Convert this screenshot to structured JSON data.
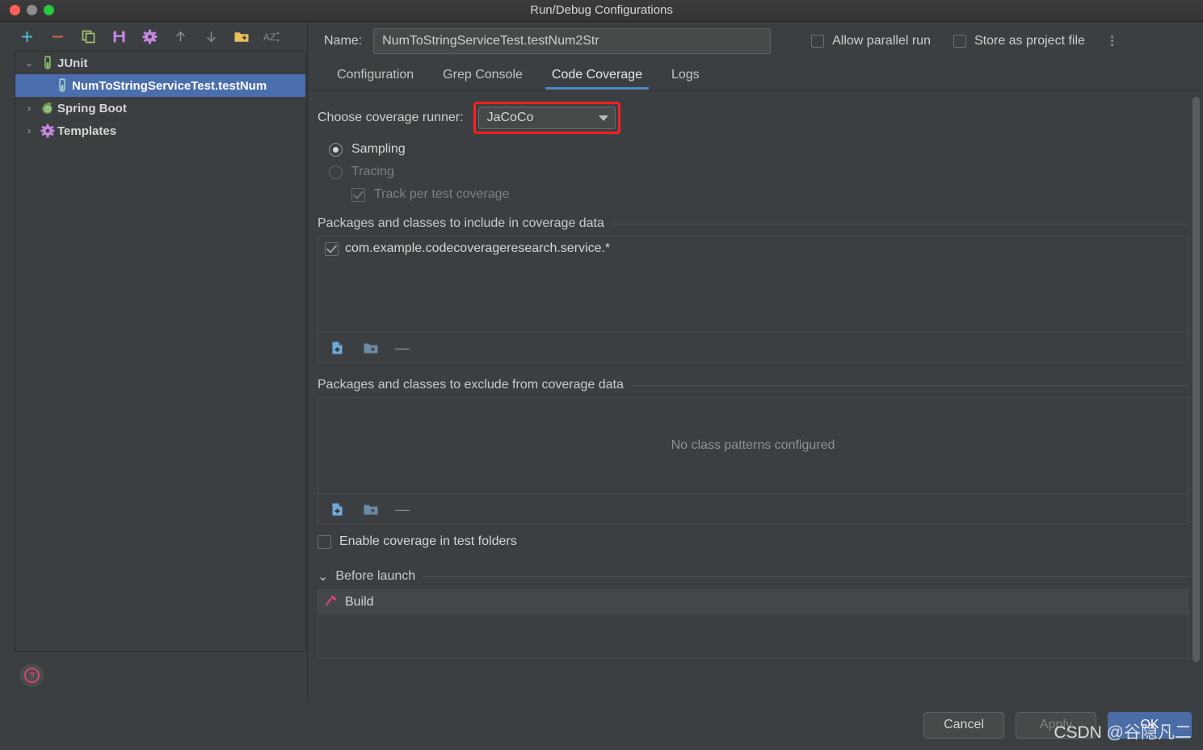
{
  "window": {
    "title": "Run/Debug Configurations",
    "controls": [
      "close",
      "minimize",
      "maximize"
    ]
  },
  "sidebar": {
    "toolbar": [
      {
        "name": "add-configuration-icon",
        "glyph": "+",
        "color": "#4fb8c8"
      },
      {
        "name": "remove-configuration-icon",
        "glyph": "−",
        "color": "#d9603f"
      },
      {
        "name": "copy-configuration-icon",
        "glyph": "copy",
        "color": "#a5cc6f"
      },
      {
        "name": "save-configuration-icon",
        "glyph": "save",
        "color": "#c586e0"
      },
      {
        "name": "edit-templates-icon",
        "glyph": "gear",
        "color": "#c586e0"
      },
      {
        "name": "move-up-icon",
        "glyph": "↑",
        "color": "#8a8d8e"
      },
      {
        "name": "move-down-icon",
        "glyph": "↓",
        "color": "#8a8d8e"
      },
      {
        "name": "new-folder-icon",
        "glyph": "folder-plus",
        "color": "#e8c15a"
      },
      {
        "name": "sort-alphabetically-icon",
        "glyph": "AZ",
        "color": "#8a8d8e"
      }
    ],
    "tree": [
      {
        "label": "JUnit",
        "arrow": "⌄",
        "expanded": true,
        "icon": "junit-icon",
        "selected": false,
        "child": false
      },
      {
        "label": "NumToStringServiceTest.testNum",
        "arrow": "",
        "expanded": false,
        "icon": "junit-test-icon",
        "selected": true,
        "child": true
      },
      {
        "label": "Spring Boot",
        "arrow": "›",
        "expanded": false,
        "icon": "spring-boot-icon",
        "selected": false,
        "child": false
      },
      {
        "label": "Templates",
        "arrow": "›",
        "expanded": false,
        "icon": "templates-gear-icon",
        "selected": false,
        "child": false
      }
    ],
    "help_glyph": "?"
  },
  "header": {
    "name_label": "Name:",
    "name_value": "NumToStringServiceTest.testNum2Str",
    "name_placeholder": "",
    "allow_parallel_run": {
      "label": "Allow parallel run",
      "checked": false
    },
    "store_as_project_file": {
      "label": "Store as project file",
      "checked": false
    },
    "kebab_label": "more-options"
  },
  "tabs": [
    {
      "label": "Configuration",
      "active": false
    },
    {
      "label": "Grep Console",
      "active": false
    },
    {
      "label": "Code Coverage",
      "active": true
    },
    {
      "label": "Logs",
      "active": false
    }
  ],
  "coverage": {
    "runner_label": "Choose coverage runner:",
    "runner_value": "JaCoCo",
    "runner_highlight_color": "#ff1f1f",
    "sampling": {
      "label": "Sampling",
      "selected": true,
      "enabled": true
    },
    "tracing": {
      "label": "Tracing",
      "selected": false,
      "enabled": false
    },
    "track_per_test": {
      "label": "Track per test coverage",
      "checked": true,
      "enabled": false
    },
    "include": {
      "title": "Packages and classes to include in coverage data",
      "items": [
        {
          "label": "com.example.codecoverageresearch.service.*",
          "checked": true
        }
      ],
      "toolbar": [
        {
          "name": "add-class-pattern-icon",
          "glyph": "file-plus"
        },
        {
          "name": "add-package-pattern-icon",
          "glyph": "folder-plus"
        },
        {
          "name": "remove-pattern-icon",
          "glyph": "—"
        }
      ]
    },
    "exclude": {
      "title": "Packages and classes to exclude from coverage data",
      "items": [],
      "empty_text": "No class patterns configured",
      "toolbar": [
        {
          "name": "add-class-pattern-icon",
          "glyph": "file-plus"
        },
        {
          "name": "add-package-pattern-icon",
          "glyph": "folder-plus"
        },
        {
          "name": "remove-pattern-icon",
          "glyph": "—"
        }
      ]
    },
    "enable_test_folders": {
      "label": "Enable coverage in test folders",
      "checked": false
    }
  },
  "before_launch": {
    "title": "Before launch",
    "arrow": "⌄",
    "tasks": [
      {
        "label": "Build",
        "icon": "hammer-icon",
        "color": "#e8447f"
      }
    ]
  },
  "footer": {
    "cancel": "Cancel",
    "apply": "Apply",
    "apply_enabled": false,
    "ok": "OK",
    "ok_color": "#4a6da7"
  },
  "watermark": "CSDN @谷隐凡二"
}
